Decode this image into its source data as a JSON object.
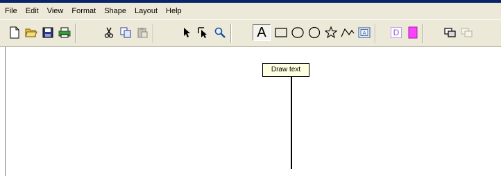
{
  "menu": [
    "File",
    "Edit",
    "View",
    "Format",
    "Shape",
    "Layout",
    "Help"
  ],
  "toolbar": {
    "text_tool_glyph": "A",
    "text_style_glyph": "D",
    "tooltip": "Draw text"
  },
  "colors": {
    "chrome": "#ece9d8",
    "title_border": "#0a246a",
    "tooltip_bg": "#ffffe1",
    "magenta_swatch": "#ff40ff",
    "text_style_purple": "#9f50d0"
  }
}
